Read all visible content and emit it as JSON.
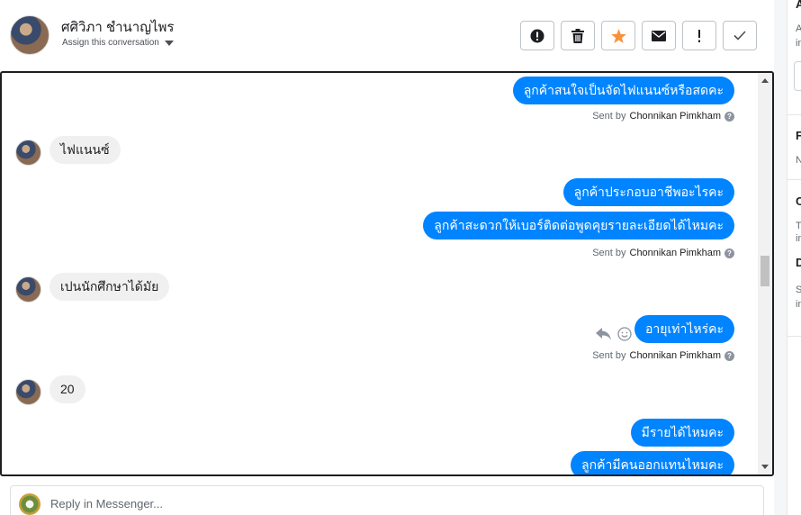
{
  "header": {
    "contact_name": "ศศิวิภา ชำนาญไพร",
    "assign_label": "Assign this conversation",
    "tools": [
      {
        "name": "mark-spam-button",
        "icon": "exclamation-circle-icon"
      },
      {
        "name": "delete-button",
        "icon": "trash-icon"
      },
      {
        "name": "star-button",
        "icon": "star-icon"
      },
      {
        "name": "mark-unread-button",
        "icon": "envelope-icon"
      },
      {
        "name": "follow-up-button",
        "icon": "exclamation-icon"
      },
      {
        "name": "mark-done-button",
        "icon": "checkmark-icon"
      }
    ]
  },
  "right_panel": {
    "line1": "A",
    "line2": "A",
    "line3": "in",
    "section2": "F",
    "section2_sub": "N",
    "section3": "C",
    "section3_l1": "To",
    "section3_l2": "in",
    "section4": "D",
    "section4_l1": "S",
    "section4_l2": "in"
  },
  "messages": {
    "m1": "ลูกค้าสนใจเป็นจัดไฟแนนซ์หรือสดคะ",
    "sent_prefix": "Sent by",
    "sender": "Chonnikan Pimkham",
    "m2": "ไฟแนนซ์",
    "m3": "ลูกค้าประกอบอาชีพอะไรคะ",
    "m4": "ลูกค้าสะดวกให้เบอร์ติดต่อพูดคุยรายละเอียดได้ไหมคะ",
    "m5": "เปนนักศึกษาได้มัย",
    "m6": "อายุเท่าไหร่คะ",
    "m7": "20",
    "m8": "มีรายได้ไหมคะ",
    "m9": "ลูกค้ามีคนออกแทนไหมคะ",
    "help": "?"
  },
  "reply": {
    "placeholder": "Reply in Messenger..."
  },
  "colors": {
    "outgoing": "#0084ff",
    "incoming": "#f1f0f0",
    "star": "#f7923b"
  }
}
